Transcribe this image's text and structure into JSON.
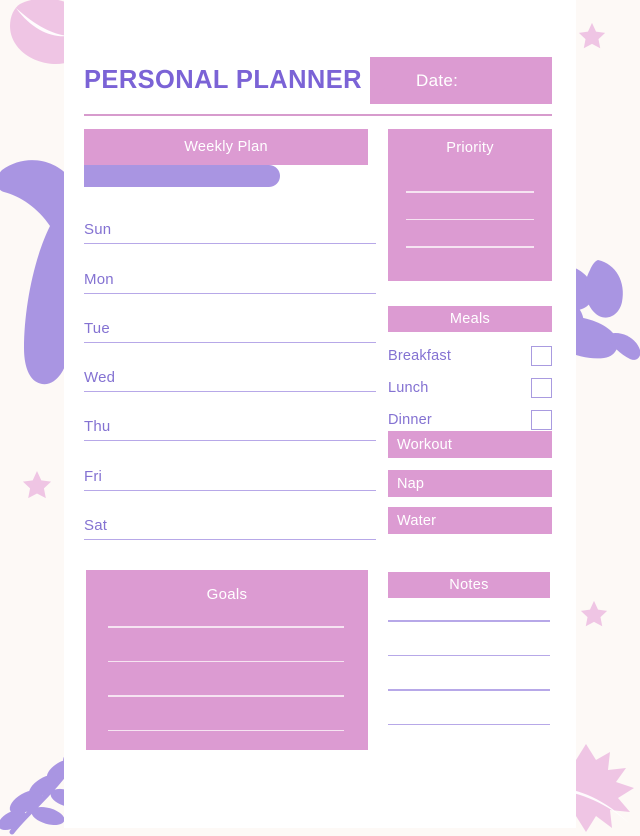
{
  "colors": {
    "background": "#FDF9F6",
    "card": "#FFFFFF",
    "pink": "#DC9BD2",
    "purple": "#8472D2",
    "purple_accent": "#A995E2",
    "line_purple": "#B7A8E8",
    "line_white": "#F6E4F2",
    "leaf_pink": "#EFC5E4",
    "leaf_purple": "#A995E2",
    "star_pink": "#EFC5E4"
  },
  "header": {
    "title": "PERSONAL PLANNER",
    "date_label": "Date:"
  },
  "weekly_plan": {
    "title": "Weekly Plan",
    "days": [
      "Sun",
      "Mon",
      "Tue",
      "Wed",
      "Thu",
      "Fri",
      "Sat"
    ]
  },
  "priority": {
    "title": "Priority",
    "line_count": 3
  },
  "meals": {
    "title": "Meals",
    "items": [
      {
        "label": "Breakfast",
        "checked": false
      },
      {
        "label": "Lunch",
        "checked": false
      },
      {
        "label": "Dinner",
        "checked": false
      }
    ]
  },
  "activities": [
    {
      "label": "Workout"
    },
    {
      "label": "Nap"
    },
    {
      "label": "Water"
    }
  ],
  "goals": {
    "title": "Goals",
    "line_count": 4
  },
  "notes": {
    "title": "Notes",
    "line_count": 4
  },
  "decorations": [
    {
      "name": "leaf-pink-top-left",
      "type": "leaf",
      "color": "#EFC5E4"
    },
    {
      "name": "leaf-purple-left",
      "type": "leaf",
      "color": "#A995E2"
    },
    {
      "name": "branch-purple-right",
      "type": "branch",
      "color": "#A995E2"
    },
    {
      "name": "fern-purple-bottom-left",
      "type": "fern",
      "color": "#A995E2"
    },
    {
      "name": "maple-leaf-pink-bottom-right",
      "type": "maple",
      "color": "#EFC5E4"
    },
    {
      "name": "star-top-center",
      "type": "star",
      "color": "#EFC5E4"
    },
    {
      "name": "star-top-right",
      "type": "star",
      "color": "#EFC5E4"
    },
    {
      "name": "star-left-mid",
      "type": "star",
      "color": "#EFC5E4"
    },
    {
      "name": "star-right-mid",
      "type": "star",
      "color": "#EFC5E4"
    },
    {
      "name": "star-bottom-center",
      "type": "star",
      "color": "#EFC5E4"
    }
  ]
}
